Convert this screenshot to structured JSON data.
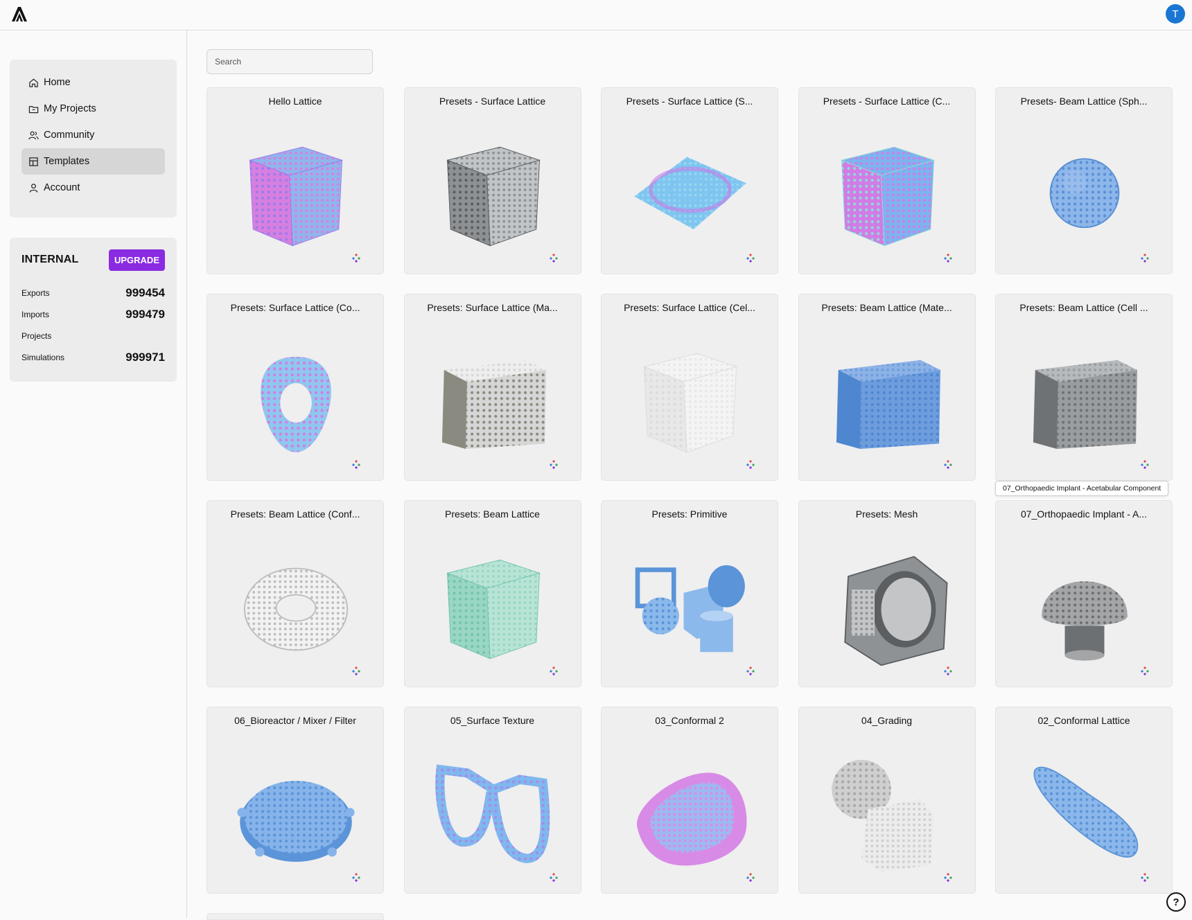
{
  "header": {
    "avatar_initial": "T"
  },
  "nav": {
    "items": [
      {
        "label": "Home",
        "icon": "home-icon"
      },
      {
        "label": "My Projects",
        "icon": "projects-icon"
      },
      {
        "label": "Community",
        "icon": "community-icon"
      },
      {
        "label": "Templates",
        "icon": "templates-icon",
        "active": true
      },
      {
        "label": "Account",
        "icon": "account-icon"
      }
    ]
  },
  "usage": {
    "plan": "INTERNAL",
    "upgrade_label": "UPGRADE",
    "stats": [
      {
        "label": "Exports",
        "value": "999454"
      },
      {
        "label": "Imports",
        "value": "999479"
      },
      {
        "label": "Projects",
        "value": ""
      },
      {
        "label": "Simulations",
        "value": "999971"
      }
    ]
  },
  "search": {
    "placeholder": "Search",
    "value": ""
  },
  "templates": [
    {
      "title": "Hello Lattice",
      "thumb": "cube",
      "colors": [
        "#9b7bea",
        "#d77fe0",
        "#8fb6ec"
      ]
    },
    {
      "title": "Presets - Surface Lattice",
      "thumb": "cube",
      "colors": [
        "#5a5e60",
        "#8d9194",
        "#c2c5c7"
      ]
    },
    {
      "title": "Presets - Surface Lattice (S...",
      "thumb": "slab",
      "colors": [
        "#c77be6",
        "#9ad6f0",
        "#7ec5f0"
      ]
    },
    {
      "title": "Presets - Surface Lattice (C...",
      "thumb": "cube",
      "colors": [
        "#8fdad8",
        "#d27be6",
        "#7cb4ef"
      ]
    },
    {
      "title": "Presets- Beam Lattice (Sph...",
      "thumb": "sphere",
      "colors": [
        "#5a8fd4",
        "#8db6ea",
        "#aac9f0"
      ]
    },
    {
      "title": "Presets: Surface Lattice (Co...",
      "thumb": "ring",
      "colors": [
        "#d47be4",
        "#8fc7ef",
        "#6dd4e0"
      ]
    },
    {
      "title": "Presets: Surface Lattice (Ma...",
      "thumb": "box",
      "colors": [
        "#8a8a80",
        "#d6d6d6",
        "#eeeeee"
      ]
    },
    {
      "title": "Presets: Surface Lattice (Cel...",
      "thumb": "cube",
      "colors": [
        "#dcdcdc",
        "#e8e8e8",
        "#f4f4f4"
      ]
    },
    {
      "title": "Presets: Beam Lattice (Mate...",
      "thumb": "box",
      "colors": [
        "#4f86d0",
        "#6d9ddd",
        "#8db2e6"
      ]
    },
    {
      "title": "Presets: Beam Lattice (Cell ...",
      "thumb": "box",
      "colors": [
        "#6f7275",
        "#9a9d9f",
        "#b7babc"
      ]
    },
    {
      "title": "Presets: Beam Lattice (Conf...",
      "thumb": "torus",
      "colors": [
        "#d9d9d9",
        "#bdbdbd",
        "#f2f2f2"
      ]
    },
    {
      "title": "Presets: Beam Lattice",
      "thumb": "cube",
      "colors": [
        "#74c4ae",
        "#99d6c4",
        "#b8e4d6"
      ]
    },
    {
      "title": "Presets: Primitive",
      "thumb": "primitives",
      "colors": [
        "#5b94d8",
        "#8cb9ec",
        "#b4d3f4"
      ]
    },
    {
      "title": "Presets: Mesh",
      "thumb": "mesh",
      "colors": [
        "#5c5f61",
        "#8f9294",
        "#c3c5c6"
      ]
    },
    {
      "title": "07_Orthopaedic Implant - A...",
      "thumb": "dome",
      "colors": [
        "#6d7073",
        "#a3a5a7",
        "#d5d6d7"
      ]
    },
    {
      "title": "06_Bioreactor / Mixer / Filter",
      "thumb": "disc",
      "colors": [
        "#5b94d8",
        "#86b3ea",
        "#b0cff2"
      ]
    },
    {
      "title": "05_Surface Texture",
      "thumb": "glasses",
      "colors": [
        "#a58be6",
        "#7fb8ee",
        "#8ed2ea"
      ]
    },
    {
      "title": "03_Conformal 2",
      "thumb": "cushion",
      "colors": [
        "#8fe0cf",
        "#d88be6",
        "#9db9f0"
      ]
    },
    {
      "title": "04_Grading",
      "thumb": "grading",
      "colors": [
        "#a7a7a7",
        "#cfcfcf",
        "#ececec"
      ]
    },
    {
      "title": "02_Conformal Lattice",
      "thumb": "insole",
      "colors": [
        "#5b94d8",
        "#8cb7ea",
        "#c5dcf6"
      ]
    }
  ],
  "tooltip": {
    "text": "07_Orthopaedic Implant - Acetabular Component"
  },
  "help_label": "?"
}
